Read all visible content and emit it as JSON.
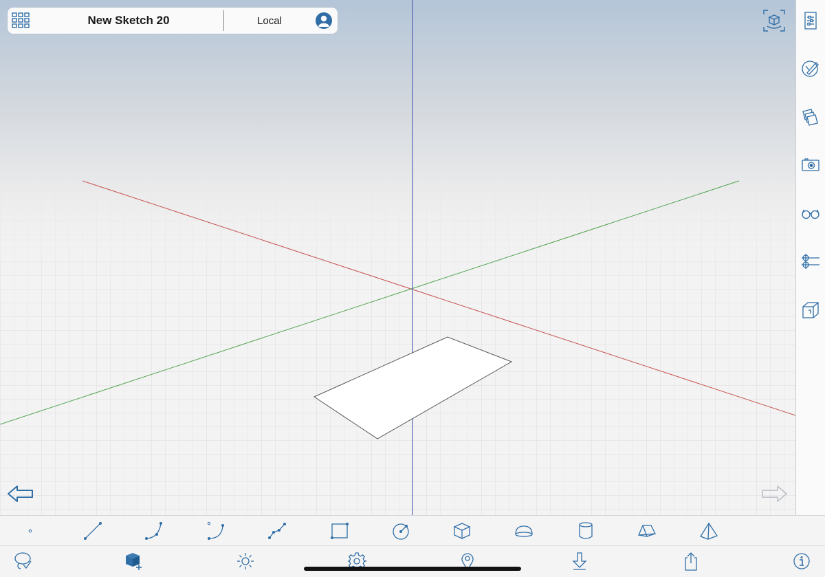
{
  "header": {
    "title": "New Sketch 20",
    "location": "Local",
    "grid_icon": "grid-icon",
    "account_icon": "user-avatar-icon"
  },
  "view": {
    "view_cube_icon": "view-cube-icon",
    "undo_icon": "undo-arrow-icon",
    "redo_icon": "redo-arrow-icon"
  },
  "right_panel": [
    "entity-info-icon",
    "materials-icon",
    "layers-icon",
    "scenes-icon",
    "display-glasses-icon",
    "outliner-icon",
    "components-icon"
  ],
  "draw_tools": [
    "point-icon",
    "line-icon",
    "arc-3pt-icon",
    "arc-2pt-icon",
    "polyline-icon",
    "rectangle-icon",
    "circle-icon",
    "box-icon",
    "hemisphere-icon",
    "cylinder-icon",
    "prism-icon",
    "pyramid-icon"
  ],
  "bottom_tools": [
    "select-lasso-icon",
    "add-object-icon",
    "sun-icon",
    "settings-gear-icon",
    "location-pin-icon",
    "download-icon",
    "share-icon",
    "info-icon"
  ],
  "colors": {
    "accent": "#2f6ea6",
    "sky_top": "#b6c6d8",
    "ground": "#f3f3f3",
    "axis_red": "#c85050",
    "axis_green": "#50a450",
    "axis_blue": "#3a4aa8"
  }
}
